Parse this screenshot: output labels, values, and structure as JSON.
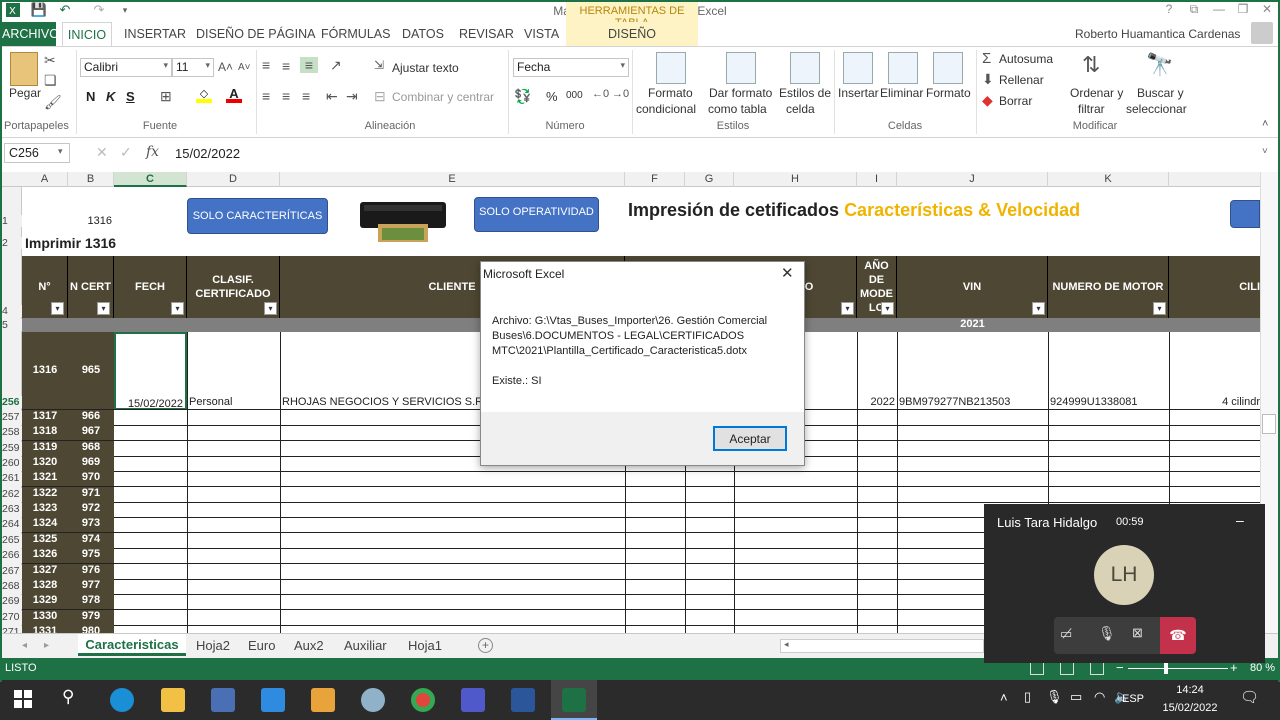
{
  "window": {
    "title": "Macro_Certificados 2021 - Excel",
    "context_title": "HERRAMIENTAS DE TABLA",
    "user": "Roberto Huamantica Cardenas"
  },
  "tabs": [
    "ARCHIVO",
    "INICIO",
    "INSERTAR",
    "DISEÑO DE PÁGINA",
    "FÓRMULAS",
    "DATOS",
    "REVISAR",
    "VISTA"
  ],
  "context_tab": "DISEÑO",
  "ribbon": {
    "portapapeles": {
      "label": "Portapapeles",
      "pegar": "Pegar"
    },
    "fuente": {
      "label": "Fuente",
      "font": "Calibri",
      "size": "11",
      "bold": "N",
      "italic": "K",
      "underline": "S"
    },
    "alineacion": {
      "label": "Alineación",
      "wrap": "Ajustar texto",
      "merge": "Combinar y centrar"
    },
    "numero": {
      "label": "Número",
      "format": "Fecha",
      "pct": "%",
      "thousands": "000"
    },
    "estilos": {
      "label": "Estilos",
      "cond": [
        "Formato",
        "condicional"
      ],
      "table": [
        "Dar formato",
        "como tabla"
      ],
      "cell": [
        "Estilos de",
        "celda"
      ]
    },
    "celdas": {
      "label": "Celdas",
      "insert": "Insertar",
      "delete": "Eliminar",
      "format": "Formato"
    },
    "modificar": {
      "label": "Modificar",
      "autosum": "Autosuma",
      "fill": "Rellenar",
      "clear": "Borrar",
      "sort": [
        "Ordenar y",
        "filtrar"
      ],
      "find": [
        "Buscar y",
        "seleccionar"
      ]
    }
  },
  "formula_bar": {
    "name_box": "C256",
    "formula": "15/02/2022",
    "fx": "fx"
  },
  "columns": [
    "A",
    "B",
    "C",
    "D",
    "E",
    "F",
    "G",
    "H",
    "I",
    "J",
    "K"
  ],
  "sheet": {
    "b1": "1316",
    "a2": "Imprimir 1316",
    "btn_caracteristicas": "SOLO CARACTERÍTICAS",
    "btn_operatividad": "SOLO OPERATIVIDAD",
    "title_white": "Impresión de cetificados ",
    "title_gold": "Características & Velocidad",
    "headers": {
      "num": "N°",
      "ncert": "N CERT",
      "fecha": "FECH",
      "clasif": "CLASIF. CERTIFICADO",
      "cliente": "CLIENTE",
      "lo": "LO",
      "anio": "AÑO DE MODE LO",
      "vin": "VIN",
      "motor": "NUMERO DE MOTOR",
      "cil": "CILI"
    },
    "year_band": "2021",
    "row256": {
      "num": "1316",
      "ncert": "965",
      "fecha": "15/02/2022",
      "clasif": "Personal",
      "cliente": "RHOJAS NEGOCIOS Y SERVICIOS S.R.L.",
      "anio": "2022",
      "vin": "9BM979277NB213503",
      "motor": "924999U1338081",
      "cil": "4 cilindr"
    },
    "rows": [
      {
        "r": "257",
        "n": "1317",
        "c": "966"
      },
      {
        "r": "258",
        "n": "1318",
        "c": "967"
      },
      {
        "r": "259",
        "n": "1319",
        "c": "968"
      },
      {
        "r": "260",
        "n": "1320",
        "c": "969"
      },
      {
        "r": "261",
        "n": "1321",
        "c": "970"
      },
      {
        "r": "262",
        "n": "1322",
        "c": "971"
      },
      {
        "r": "263",
        "n": "1323",
        "c": "972"
      },
      {
        "r": "264",
        "n": "1324",
        "c": "973"
      },
      {
        "r": "265",
        "n": "1325",
        "c": "974"
      },
      {
        "r": "266",
        "n": "1326",
        "c": "975"
      },
      {
        "r": "267",
        "n": "1327",
        "c": "976"
      },
      {
        "r": "268",
        "n": "1328",
        "c": "977"
      },
      {
        "r": "269",
        "n": "1329",
        "c": "978"
      },
      {
        "r": "270",
        "n": "1330",
        "c": "979"
      },
      {
        "r": "271",
        "n": "1331",
        "c": "980"
      }
    ],
    "row_nums_top": [
      "1",
      "2",
      "4",
      "5",
      "256"
    ]
  },
  "dialog": {
    "title": "Microsoft Excel",
    "line1": "Archivo: G:\\Vtas_Buses_Importer\\26. Gestión Comercial",
    "line2": "Buses\\6.DOCUMENTOS - LEGAL\\CERTIFICADOS",
    "line3": "MTC\\2021\\Plantilla_Certificado_Caracteristica5.dotx",
    "line4": "Existe.: SI",
    "ok": "Aceptar"
  },
  "sheet_tabs": [
    "Caracteristicas",
    "Hoja2",
    "Euro",
    "Aux2",
    "Auxiliar",
    "Hoja1"
  ],
  "status": {
    "text": "LISTO",
    "zoom": "80 %"
  },
  "teams": {
    "name": "Luis Tara Hidalgo",
    "time": "00:59",
    "initials": "LH"
  },
  "taskbar": {
    "lang": "ESP",
    "time": "14:24",
    "date": "15/02/2022"
  }
}
